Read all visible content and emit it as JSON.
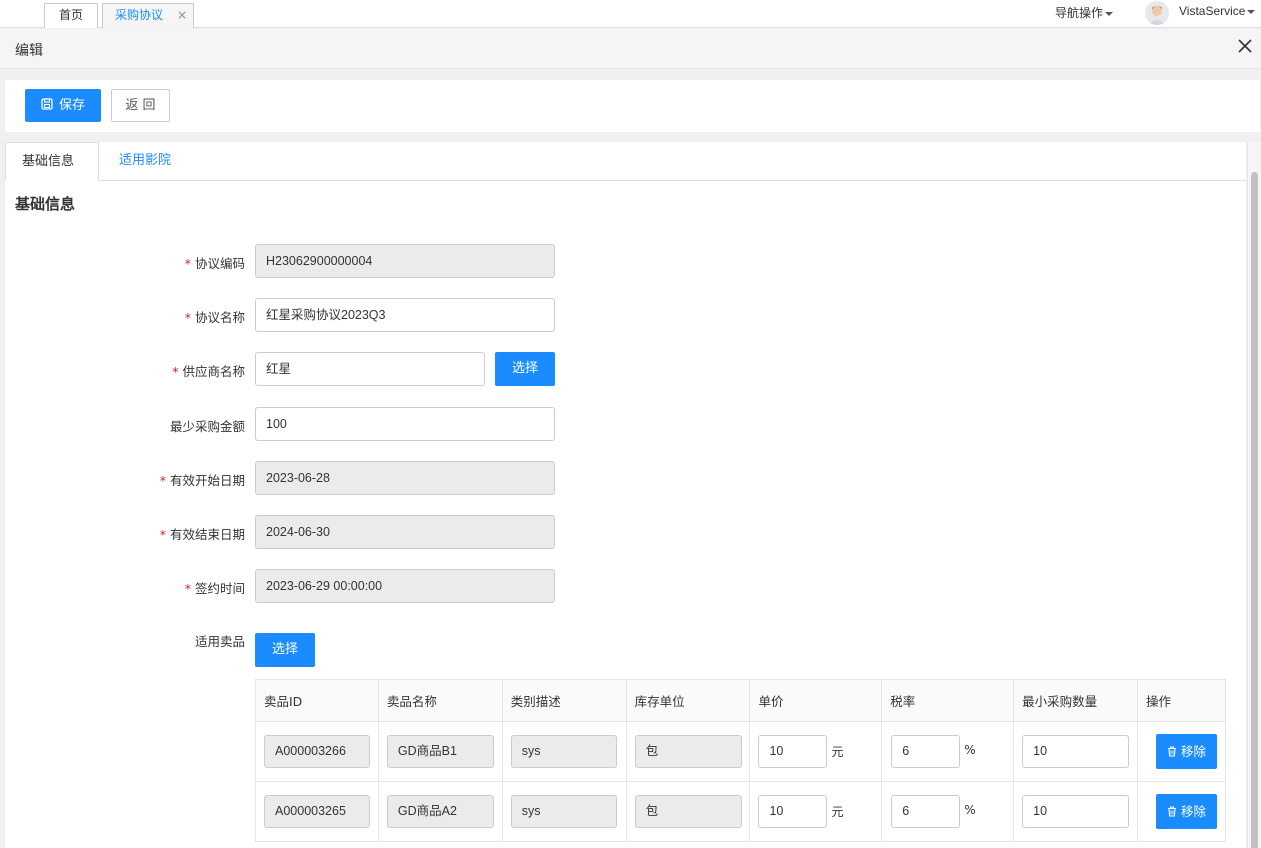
{
  "tabs": [
    {
      "label": "首页"
    },
    {
      "label": "采购协议",
      "close": "×"
    }
  ],
  "header": {
    "nav_ops": "导航操作",
    "user": "VistaService"
  },
  "edit": {
    "title": "编辑"
  },
  "toolbar": {
    "save_label": "保存",
    "back_label": "返 回"
  },
  "subtabs": [
    "基础信息",
    "适用影院"
  ],
  "section_title": "基础信息",
  "form": {
    "code_label": "协议编码",
    "code_value": "H23062900000004",
    "name_label": "协议名称",
    "name_value": "红星采购协议2023Q3",
    "supplier_label": "供应商名称",
    "supplier_value": "红星",
    "supplier_btn": "选择",
    "min_amount_label": "最少采购金额",
    "min_amount_value": "100",
    "start_label": "有效开始日期",
    "start_value": "2023-06-28",
    "end_label": "有效结束日期",
    "end_value": "2024-06-30",
    "sign_label": "签约时间",
    "sign_value": "2023-06-29 00:00:00",
    "products_label": "适用卖品",
    "products_btn": "选择"
  },
  "table": {
    "headers": [
      "卖品ID",
      "卖品名称",
      "类别描述",
      "库存单位",
      "单价",
      "税率",
      "最小采购数量",
      "操作"
    ],
    "rows": [
      {
        "id": "A000003266",
        "name": "GD商品B1",
        "category": "sys",
        "unit": "包",
        "price": "10",
        "price_unit": "元",
        "tax": "6",
        "tax_unit": "%",
        "min_qty": "10",
        "action": "移除"
      },
      {
        "id": "A000003265",
        "name": "GD商品A2",
        "category": "sys",
        "unit": "包",
        "price": "10",
        "price_unit": "元",
        "tax": "6",
        "tax_unit": "%",
        "min_qty": "10",
        "action": "移除"
      }
    ]
  },
  "colors": {
    "accent": "#1a8cff",
    "required": "#e02020"
  }
}
